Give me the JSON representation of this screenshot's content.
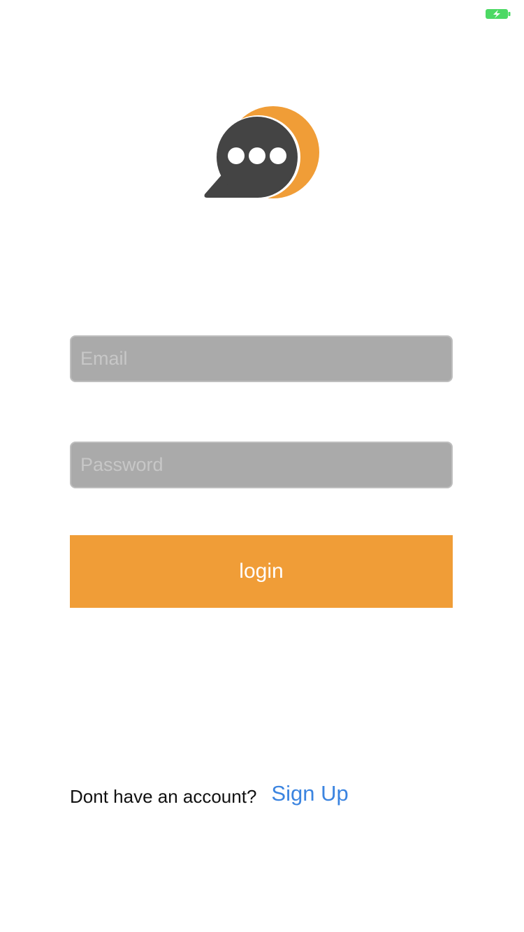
{
  "status_bar": {
    "battery_icon": "battery-charging-icon",
    "battery_color": "#4cd964"
  },
  "logo": {
    "icon": "chat-bubble-logo-icon",
    "primary_color": "#444444",
    "accent_color": "#f09d37"
  },
  "login_form": {
    "email": {
      "placeholder": "Email",
      "value": ""
    },
    "password": {
      "placeholder": "Password",
      "value": ""
    },
    "login_label": "login",
    "login_color": "#f09d37"
  },
  "signup": {
    "prompt": "Dont have an account?",
    "link_label": "Sign Up",
    "link_color": "#3b84e0"
  }
}
